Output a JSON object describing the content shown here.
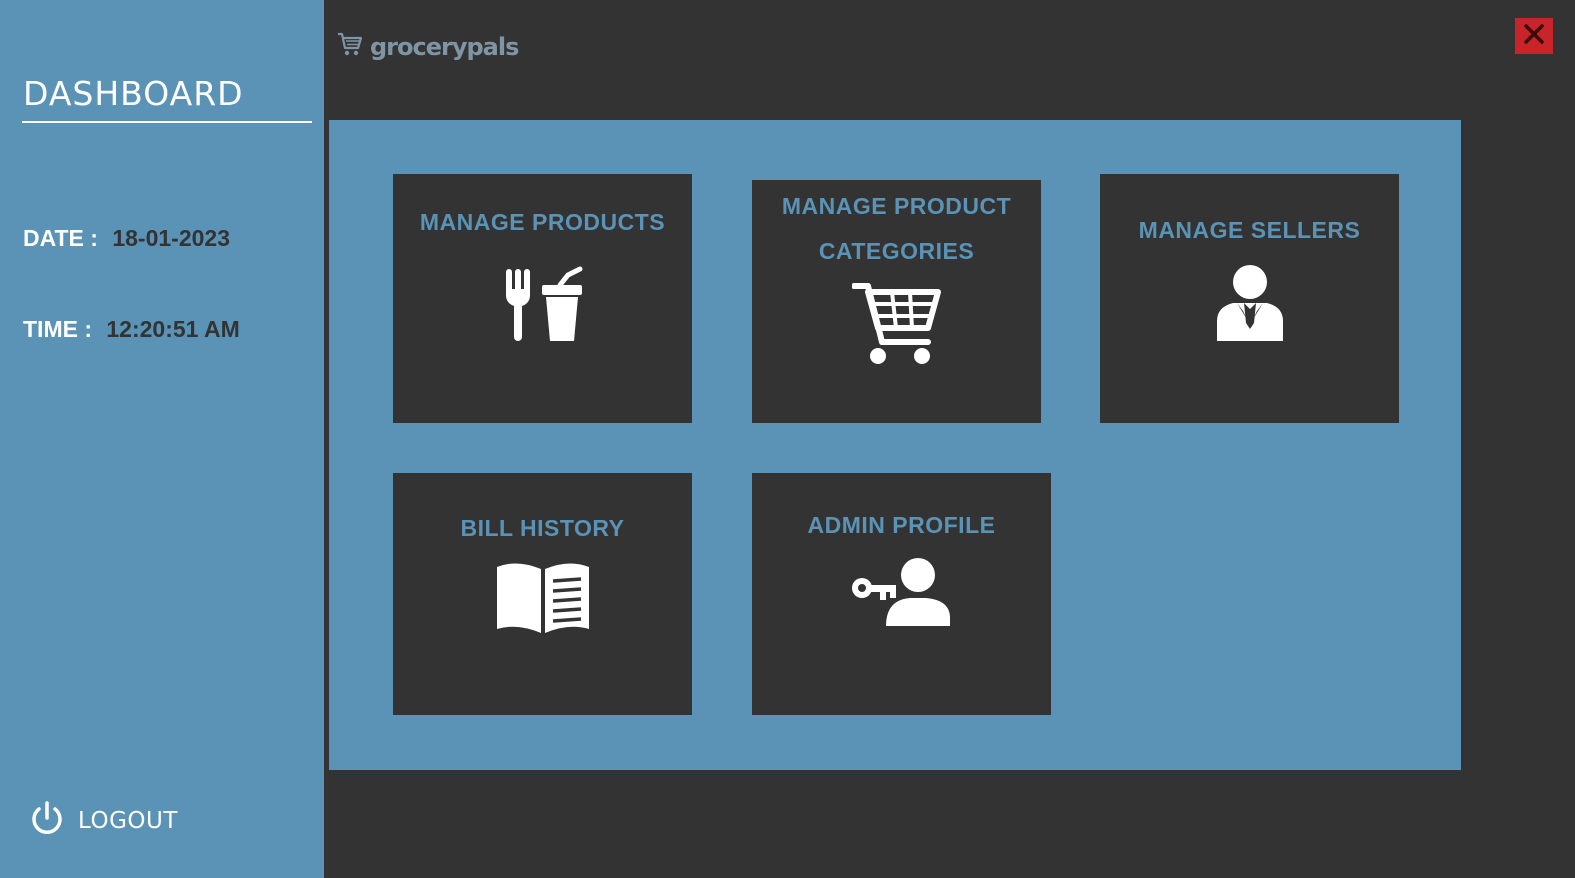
{
  "sidebar": {
    "title": "DASHBOARD",
    "date_label": "DATE :",
    "date_value": "18-01-2023",
    "time_label": "TIME :",
    "time_value": "12:20:51 AM",
    "logout_label": "LOGOUT",
    "logout_icon": "power-icon"
  },
  "header": {
    "brand_name": "grocerypals",
    "brand_icon": "cart-icon",
    "close_icon": "close-icon"
  },
  "tiles": [
    {
      "label": "MANAGE PRODUCTS",
      "icon": "food-drink-icon"
    },
    {
      "label": "MANAGE PRODUCT CATEGORIES",
      "icon": "shopping-cart-icon"
    },
    {
      "label": "MANAGE SELLERS",
      "icon": "businessman-icon"
    },
    {
      "label": "BILL HISTORY",
      "icon": "open-book-icon"
    },
    {
      "label": "ADMIN PROFILE",
      "icon": "admin-key-user-icon"
    }
  ],
  "colors": {
    "sidebar_bg": "#5a93b6",
    "app_bg": "#333333",
    "accent_text": "#5a93b6",
    "close_button": "#c8242a",
    "brand_text": "#7f95a4"
  }
}
